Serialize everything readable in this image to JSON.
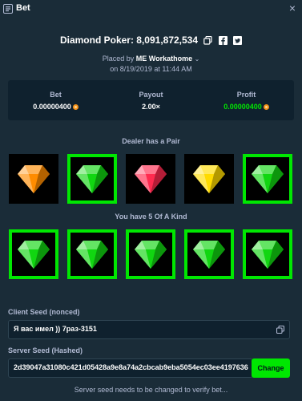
{
  "window": {
    "title": "Bet",
    "close_icon": "close-icon"
  },
  "headline": {
    "text": "Diamond Poker: 8,091,872,534"
  },
  "placed": {
    "prefix": "Placed by",
    "user": "ME Workathome",
    "date": "on 8/19/2019 at 11:44 AM"
  },
  "stats": {
    "bet": {
      "label": "Bet",
      "value": "0.00000400",
      "currency_icon": "bitcoin-icon"
    },
    "payout": {
      "label": "Payout",
      "value": "2.00×"
    },
    "profit": {
      "label": "Profit",
      "value": "0.00000400",
      "currency_icon": "bitcoin-icon"
    }
  },
  "dealer": {
    "label": "Dealer has a Pair",
    "gems": [
      {
        "name": "orange",
        "color": "#ff8c00",
        "win": false
      },
      {
        "name": "green",
        "color": "#11d611",
        "win": true
      },
      {
        "name": "red",
        "color": "#ff2a4f",
        "win": false
      },
      {
        "name": "yellow",
        "color": "#ffdb00",
        "win": false
      },
      {
        "name": "green",
        "color": "#11d611",
        "win": true
      }
    ]
  },
  "player": {
    "label": "You have 5 Of A Kind",
    "gems": [
      {
        "name": "green",
        "color": "#11d611",
        "win": true
      },
      {
        "name": "green",
        "color": "#11d611",
        "win": true
      },
      {
        "name": "green",
        "color": "#11d611",
        "win": true
      },
      {
        "name": "green",
        "color": "#11d611",
        "win": true
      },
      {
        "name": "green",
        "color": "#11d611",
        "win": true
      }
    ]
  },
  "client_seed": {
    "label": "Client Seed (nonced)",
    "value": "Я вас имел )) 7раз-3151"
  },
  "server_seed": {
    "label": "Server Seed (Hashed)",
    "value": "2d39047a31080c421d05428a9e8a74a2cbcab9eba5054ec03ee4197636",
    "button": "Change"
  },
  "note": "Server seed needs to be changed to verify bet...",
  "colors": {
    "background": "#1a2c38",
    "panel": "#0f212e",
    "accent_green": "#00e701",
    "muted_text": "#b1bad3"
  }
}
